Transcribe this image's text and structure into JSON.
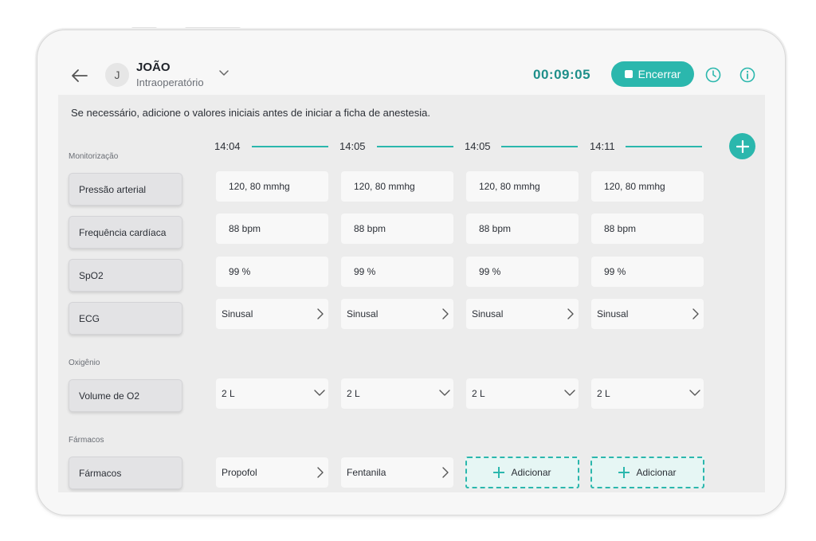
{
  "header": {
    "avatar_initial": "J",
    "patient_name": "JOÃO",
    "phase": "Intraoperatório",
    "timer": "00:09:05",
    "end_button": "Encerrar"
  },
  "hint": "Se necessário, adicione o valores iniciais antes de iniciar a ficha de anestesia.",
  "times": [
    "14:04",
    "14:05",
    "14:05",
    "14:11"
  ],
  "sections": {
    "monitoring": "Monitorização",
    "oxygen": "Oxigênio",
    "drugs": "Fármacos"
  },
  "rows": {
    "blood_pressure": {
      "label": "Pressão arterial",
      "values": [
        "120, 80 mmhg",
        "120, 80 mmhg",
        "120, 80 mmhg",
        "120, 80 mmhg"
      ]
    },
    "heart_rate": {
      "label": "Frequência cardíaca",
      "values": [
        "88 bpm",
        "88 bpm",
        "88 bpm",
        "88 bpm"
      ]
    },
    "spo2": {
      "label": "SpO2",
      "values": [
        "99 %",
        "99 %",
        "99 %",
        "99 %"
      ]
    },
    "ecg": {
      "label": "ECG",
      "values": [
        "Sinusal",
        "Sinusal",
        "Sinusal",
        "Sinusal"
      ]
    },
    "o2_volume": {
      "label": "Volume de O2",
      "values": [
        "2 L",
        "2 L",
        "2 L",
        "2 L"
      ]
    },
    "drugs": {
      "label": "Fármacos",
      "values": [
        "Propofol",
        "Fentanila"
      ],
      "add_label": "Adicionar"
    }
  },
  "colors": {
    "accent": "#2bb7ad",
    "timer": "#1e8f8a",
    "add_cell_bg": "#e6f6f4"
  },
  "icons": {
    "back": "arrow-left-icon",
    "dropdown": "chevron-down-icon",
    "stop": "stop-icon",
    "history": "clock-history-icon",
    "info": "info-icon",
    "add": "plus-icon",
    "row_chevron": "chevron-right-icon"
  }
}
